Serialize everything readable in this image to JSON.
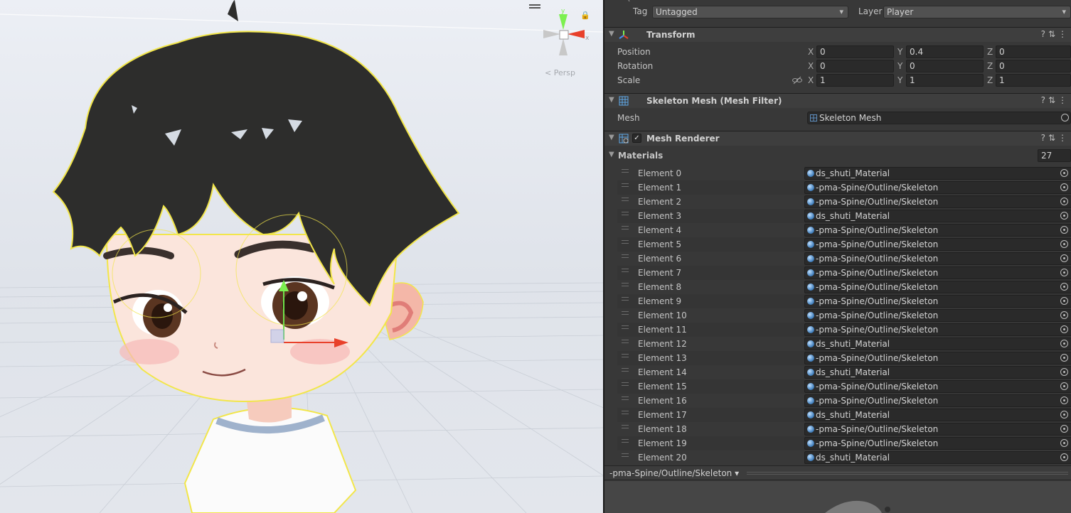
{
  "scene": {
    "projection_label": "< Persp",
    "gizmo_axes": {
      "x": "x",
      "y": "y"
    }
  },
  "inspector": {
    "tag_label": "Tag",
    "tag_value": "Untagged",
    "layer_label": "Layer",
    "layer_value": "Player",
    "transform": {
      "title": "Transform",
      "position_label": "Position",
      "rotation_label": "Rotation",
      "scale_label": "Scale",
      "position": {
        "x": "0",
        "y": "0.4",
        "z": "0"
      },
      "rotation": {
        "x": "0",
        "y": "0",
        "z": "0"
      },
      "scale": {
        "x": "1",
        "y": "1",
        "z": "1"
      },
      "axis_x": "X",
      "axis_y": "Y",
      "axis_z": "Z"
    },
    "mesh_filter": {
      "title": "Skeleton Mesh (Mesh Filter)",
      "mesh_label": "Mesh",
      "mesh_value": "Skeleton Mesh"
    },
    "mesh_renderer": {
      "title": "Mesh Renderer",
      "enabled": true,
      "materials_label": "Materials",
      "materials_count": "27",
      "elements": [
        {
          "name": "Element 0",
          "material": "ds_shuti_Material"
        },
        {
          "name": "Element 1",
          "material": "-pma-Spine/Outline/Skeleton"
        },
        {
          "name": "Element 2",
          "material": "-pma-Spine/Outline/Skeleton"
        },
        {
          "name": "Element 3",
          "material": "ds_shuti_Material"
        },
        {
          "name": "Element 4",
          "material": "-pma-Spine/Outline/Skeleton"
        },
        {
          "name": "Element 5",
          "material": "-pma-Spine/Outline/Skeleton"
        },
        {
          "name": "Element 6",
          "material": "-pma-Spine/Outline/Skeleton"
        },
        {
          "name": "Element 7",
          "material": "-pma-Spine/Outline/Skeleton"
        },
        {
          "name": "Element 8",
          "material": "-pma-Spine/Outline/Skeleton"
        },
        {
          "name": "Element 9",
          "material": "-pma-Spine/Outline/Skeleton"
        },
        {
          "name": "Element 10",
          "material": "-pma-Spine/Outline/Skeleton"
        },
        {
          "name": "Element 11",
          "material": "-pma-Spine/Outline/Skeleton"
        },
        {
          "name": "Element 12",
          "material": "ds_shuti_Material"
        },
        {
          "name": "Element 13",
          "material": "-pma-Spine/Outline/Skeleton"
        },
        {
          "name": "Element 14",
          "material": "ds_shuti_Material"
        },
        {
          "name": "Element 15",
          "material": "-pma-Spine/Outline/Skeleton"
        },
        {
          "name": "Element 16",
          "material": "-pma-Spine/Outline/Skeleton"
        },
        {
          "name": "Element 17",
          "material": "ds_shuti_Material"
        },
        {
          "name": "Element 18",
          "material": "-pma-Spine/Outline/Skeleton"
        },
        {
          "name": "Element 19",
          "material": "-pma-Spine/Outline/Skeleton"
        },
        {
          "name": "Element 20",
          "material": "ds_shuti_Material"
        }
      ]
    },
    "material_selector": "-pma-Spine/Outline/Skeleton"
  },
  "colors": {
    "panel_bg": "#383838",
    "field_bg": "#2a2a2a",
    "header_bg": "#3e3e3e",
    "gizmo_y": "#7cf050",
    "gizmo_x": "#e8402a",
    "selection_outline": "#f2e64a"
  }
}
